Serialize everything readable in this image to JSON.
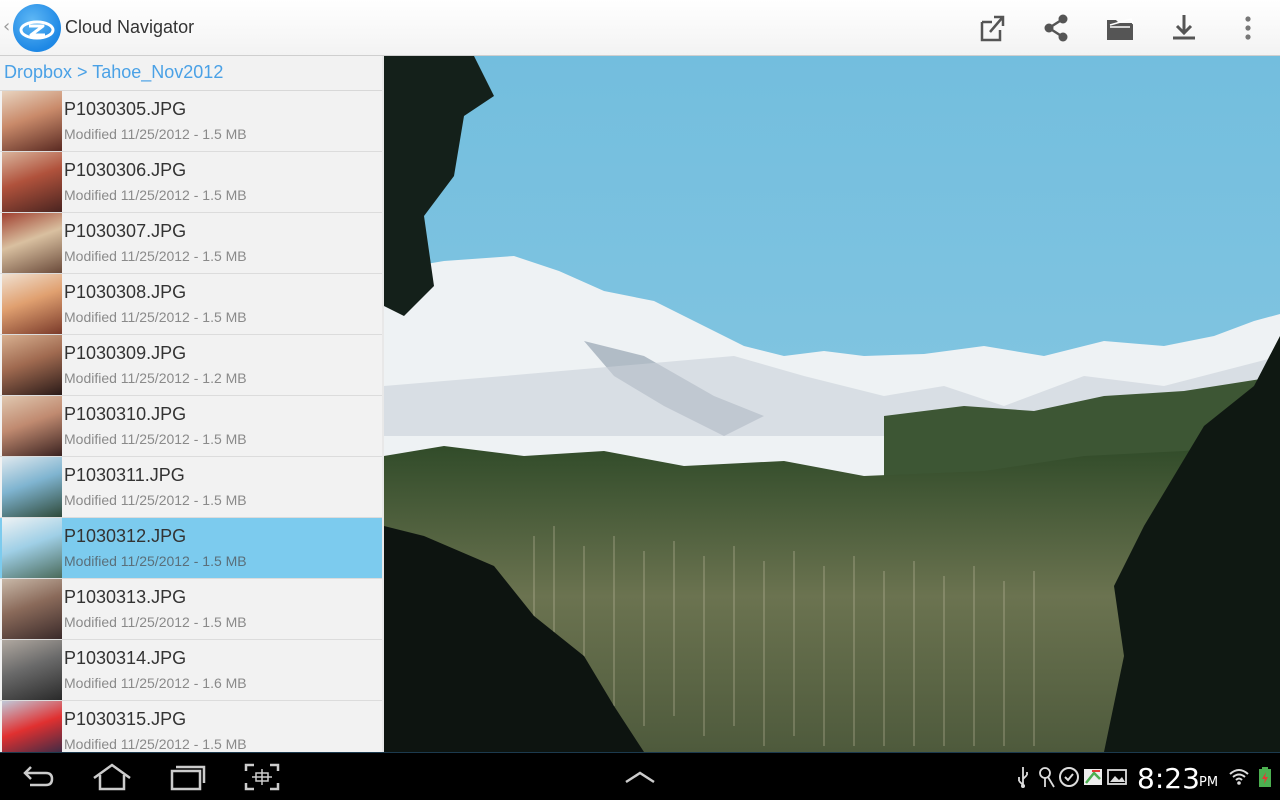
{
  "app": {
    "title": "Cloud Navigator",
    "up_caret": "‹"
  },
  "toolbar": {
    "icons": [
      "open-external-icon",
      "share-icon",
      "open-folder-icon",
      "download-icon",
      "overflow-menu-icon"
    ]
  },
  "breadcrumb": {
    "text": "Dropbox > Tahoe_Nov2012"
  },
  "files": [
    {
      "name": "P1030305.JPG",
      "meta": "Modified 11/25/2012 - 1.5 MB",
      "selected": false
    },
    {
      "name": "P1030306.JPG",
      "meta": "Modified 11/25/2012 - 1.5 MB",
      "selected": false
    },
    {
      "name": "P1030307.JPG",
      "meta": "Modified 11/25/2012 - 1.5 MB",
      "selected": false
    },
    {
      "name": "P1030308.JPG",
      "meta": "Modified 11/25/2012 - 1.5 MB",
      "selected": false
    },
    {
      "name": "P1030309.JPG",
      "meta": "Modified 11/25/2012 - 1.2 MB",
      "selected": false
    },
    {
      "name": "P1030310.JPG",
      "meta": "Modified 11/25/2012 - 1.5 MB",
      "selected": false
    },
    {
      "name": "P1030311.JPG",
      "meta": "Modified 11/25/2012 - 1.5 MB",
      "selected": false
    },
    {
      "name": "P1030312.JPG",
      "meta": "Modified 11/25/2012 - 1.5 MB",
      "selected": true
    },
    {
      "name": "P1030313.JPG",
      "meta": "Modified 11/25/2012 - 1.5 MB",
      "selected": false
    },
    {
      "name": "P1030314.JPG",
      "meta": "Modified 11/25/2012 - 1.6 MB",
      "selected": false
    },
    {
      "name": "P1030315.JPG",
      "meta": "Modified 11/25/2012 - 1.5 MB",
      "selected": false
    }
  ],
  "status": {
    "time": "8:23",
    "ampm": "PM"
  },
  "colors": {
    "accent": "#4aa1e6",
    "selected_row": "#7ccbee",
    "sky": "#7cc2dc"
  }
}
